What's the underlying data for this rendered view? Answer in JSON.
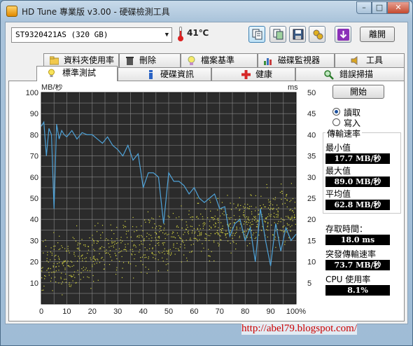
{
  "window": {
    "title": "HD Tune 專業版 v3.00 - 硬碟檢測工具",
    "min": "–",
    "max": "□",
    "close": "✕"
  },
  "toolbar": {
    "drive": "ST9320421AS (320 GB)",
    "temperature": "41",
    "temp_unit": "℃",
    "exit_label": "離開",
    "icons": [
      "copy-text-icon",
      "copy-screenshot-icon",
      "save-icon",
      "options-icon",
      "download-icon"
    ]
  },
  "tabs_back": [
    {
      "label": "資料夾使用率",
      "icon": "folder-icon"
    },
    {
      "label": "刪除",
      "icon": "trash-icon"
    },
    {
      "label": "檔案基準",
      "icon": "file-benchmark-icon"
    },
    {
      "label": "磁碟監視器",
      "icon": "disk-monitor-icon"
    },
    {
      "label": "工具",
      "icon": "tools-icon"
    }
  ],
  "tabs_front": [
    {
      "label": "標準測試",
      "icon": "bulb-icon",
      "active": true
    },
    {
      "label": "硬碟資訊",
      "icon": "info-icon"
    },
    {
      "label": "健康",
      "icon": "health-icon"
    },
    {
      "label": "錯誤掃描",
      "icon": "magnifier-icon"
    }
  ],
  "controls": {
    "start_label": "開始",
    "read_label": "讀取",
    "write_label": "寫入",
    "selected_mode": "read"
  },
  "stats": {
    "transfer_rate_title": "傳輸速率",
    "min_label": "最小值",
    "min_value": "17.7 MB/秒",
    "max_label": "最大值",
    "max_value": "89.0 MB/秒",
    "avg_label": "平均值",
    "avg_value": "62.8 MB/秒",
    "access_label": "存取時間：",
    "access_value": "18.0 ms",
    "burst_label": "突發傳輸速率",
    "burst_value": "73.7 MB/秒",
    "cpu_label": "CPU 使用率",
    "cpu_value": "8.1%"
  },
  "chart_data": {
    "type": "line",
    "y_left_label": "MB/秒",
    "y_right_label": "ms",
    "x_ticks": [
      "0",
      "10",
      "20",
      "30",
      "40",
      "50",
      "60",
      "70",
      "80",
      "90",
      "100%"
    ],
    "y_left_ticks": [
      "10",
      "20",
      "30",
      "40",
      "50",
      "60",
      "70",
      "80",
      "90",
      "100"
    ],
    "y_right_ticks": [
      "5",
      "10",
      "15",
      "20",
      "25",
      "30",
      "35",
      "40",
      "45",
      "50"
    ],
    "ylim_left": [
      0,
      100
    ],
    "ylim_right": [
      0,
      50
    ],
    "xlim": [
      0,
      100
    ],
    "grid": true,
    "series_transfer": {
      "color": "#4fa3d9",
      "x": [
        0,
        1,
        2,
        3,
        4,
        5,
        6,
        7,
        8,
        9,
        10,
        12,
        14,
        16,
        18,
        20,
        22,
        24,
        26,
        28,
        30,
        32,
        34,
        36,
        38,
        40,
        42,
        44,
        46,
        48,
        50,
        52,
        54,
        56,
        58,
        60,
        62,
        64,
        66,
        68,
        70,
        72,
        74,
        76,
        78,
        80,
        82,
        84,
        86,
        88,
        90,
        92,
        94,
        96,
        98,
        100
      ],
      "y": [
        84,
        86,
        70,
        83,
        80,
        45,
        85,
        78,
        82,
        80,
        79,
        82,
        78,
        81,
        80,
        80,
        78,
        76,
        79,
        75,
        73,
        70,
        75,
        68,
        71,
        55,
        62,
        62,
        60,
        38,
        62,
        58,
        58,
        56,
        52,
        55,
        50,
        48,
        50,
        52,
        45,
        46,
        32,
        38,
        40,
        30,
        36,
        20,
        45,
        30,
        18,
        38,
        25,
        36,
        30,
        33
      ]
    },
    "access_scatter": {
      "color": "#d8d840",
      "description_trend": "access time band rising from ~9 ms at start to ~22 ms at end"
    }
  },
  "watermark": {
    "url": "http://abel79.blogspot.com/"
  }
}
